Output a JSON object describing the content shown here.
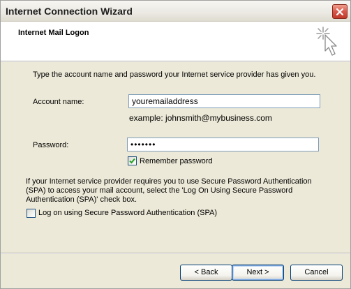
{
  "window": {
    "title": "Internet Connection Wizard"
  },
  "header": {
    "title": "Internet Mail Logon",
    "icon": "wizard-star-cursor-icon"
  },
  "intro_text": "Type the account name and password your Internet service provider has given you.",
  "account": {
    "label": "Account name:",
    "value": "youremailaddress",
    "example": "example: johnsmith@mybusiness.com"
  },
  "password": {
    "label": "Password:",
    "masked_value": "•••••••"
  },
  "remember_password": {
    "label": "Remember password",
    "checked": true
  },
  "spa": {
    "description": "If your Internet service provider requires you to use Secure Password Authentication (SPA) to access your mail account, select the 'Log On Using Secure Password Authentication (SPA)' check box.",
    "checkbox_label": "Log on using Secure Password Authentication (SPA)",
    "checked": false
  },
  "buttons": {
    "back": "< Back",
    "next": "Next >",
    "cancel": "Cancel"
  },
  "colors": {
    "dialog_bg": "#ece9d8",
    "close_button": "#c1392b",
    "check_mark": "#21a121"
  }
}
